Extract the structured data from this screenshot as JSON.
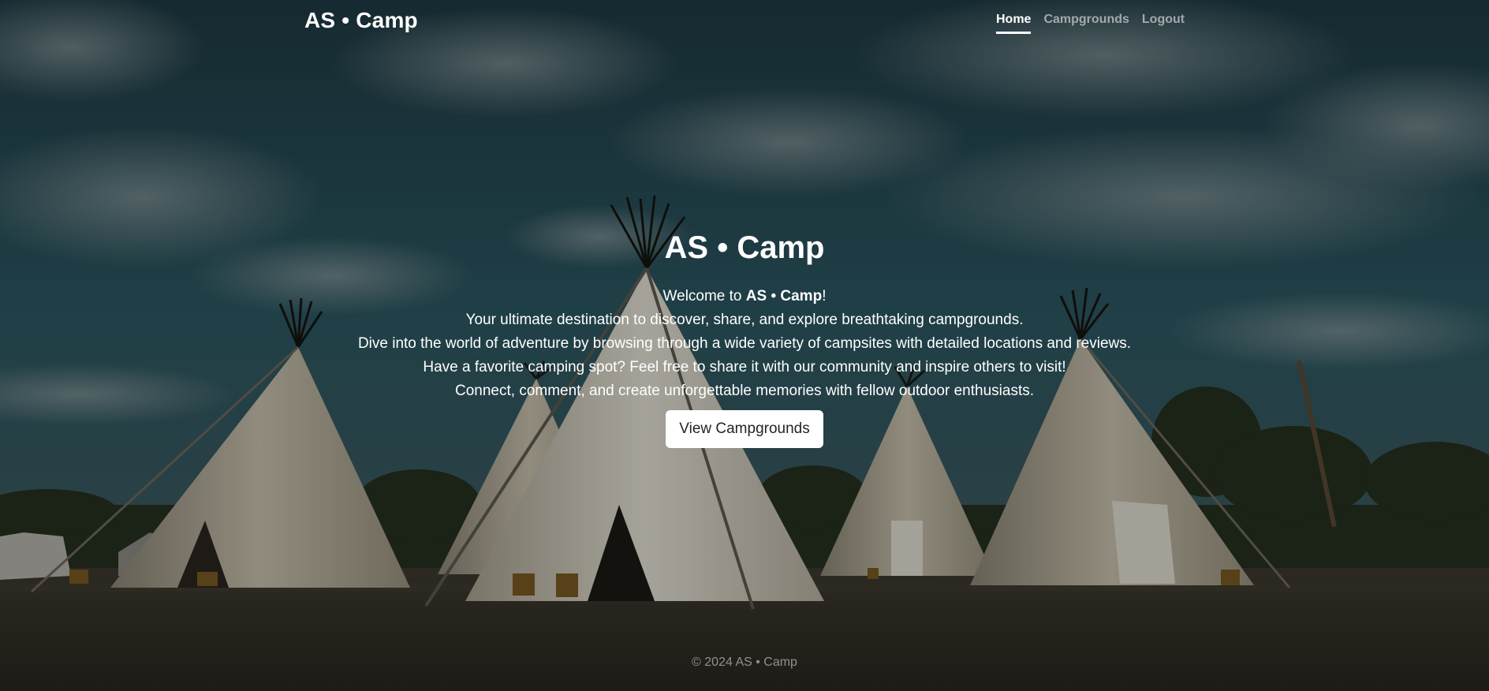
{
  "navbar": {
    "brand": "AS • Camp",
    "links": [
      {
        "label": "Home",
        "active": true
      },
      {
        "label": "Campgrounds",
        "active": false
      },
      {
        "label": "Logout",
        "active": false
      }
    ]
  },
  "hero": {
    "title": "AS • Camp",
    "welcome_prefix": "Welcome to ",
    "welcome_brand": "AS • Camp",
    "welcome_suffix": "!",
    "lines": [
      "Your ultimate destination to discover, share, and explore breathtaking campgrounds.",
      "Dive into the world of adventure by browsing through a wide variety of campsites with detailed locations and reviews.",
      "Have a favorite camping spot? Feel free to share it with our community and inspire others to visit!",
      "Connect, comment, and create unforgettable memories with fellow outdoor enthusiasts."
    ],
    "button_label": "View Campgrounds"
  },
  "footer": {
    "text": "© 2024 AS • Camp"
  },
  "colors": {
    "sky": "#2e5660",
    "ground": "#3a352c",
    "tent": "#b9b2a0",
    "text": "#ffffff"
  }
}
